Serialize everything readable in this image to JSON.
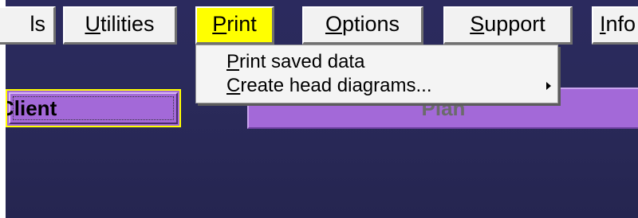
{
  "menubar": {
    "items": [
      {
        "label": "ls",
        "accel_prefix": "",
        "accel": "",
        "accel_suffix": "ls"
      },
      {
        "label": "Utilities",
        "accel_prefix": "",
        "accel": "U",
        "accel_suffix": "tilities"
      },
      {
        "label": "Print",
        "accel_prefix": "",
        "accel": "P",
        "accel_suffix": "rint",
        "active": true
      },
      {
        "label": "Options",
        "accel_prefix": "",
        "accel": "O",
        "accel_suffix": "ptions"
      },
      {
        "label": "Support",
        "accel_prefix": "",
        "accel": "S",
        "accel_suffix": "upport"
      },
      {
        "label": "Info",
        "accel_prefix": "",
        "accel": "I",
        "accel_suffix": "nfo"
      }
    ]
  },
  "print_menu": {
    "items": [
      {
        "accel": "P",
        "rest": "rint saved data"
      },
      {
        "accel": "C",
        "rest": "reate head diagrams...",
        "has_submenu": true
      }
    ]
  },
  "buttons": {
    "client": "Client",
    "plan": "Plan"
  },
  "colors": {
    "background": "#2a2a5a",
    "active_menu": "#ffff00",
    "button_purple": "#a369d8"
  }
}
